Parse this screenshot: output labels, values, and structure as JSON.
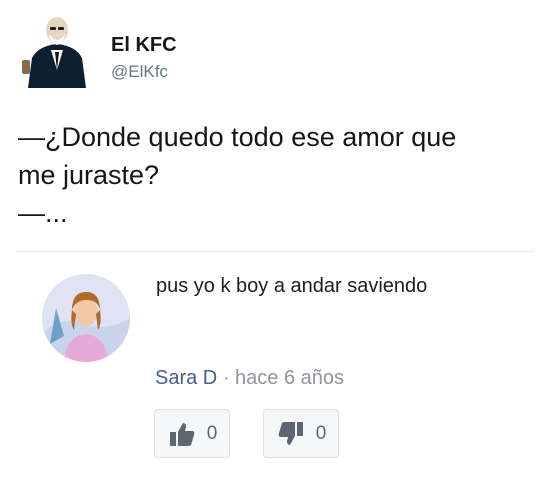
{
  "tweet": {
    "name": "El KFC",
    "handle": "@ElKfc",
    "lines": [
      "—¿Donde quedo todo ese amor que",
      "me juraste?",
      "—..."
    ]
  },
  "comment": {
    "text": "pus yo k boy a andar saviendo",
    "author": "Sara D",
    "separator": "·",
    "time": "hace 6 años",
    "like_count": "0",
    "dislike_count": "0",
    "icons": {
      "like": "thumbs-up-icon",
      "dislike": "thumbs-down-icon"
    }
  },
  "colors": {
    "author": "#4b5a96",
    "meta": "#90949c",
    "button_bg": "#f6f7f9"
  }
}
